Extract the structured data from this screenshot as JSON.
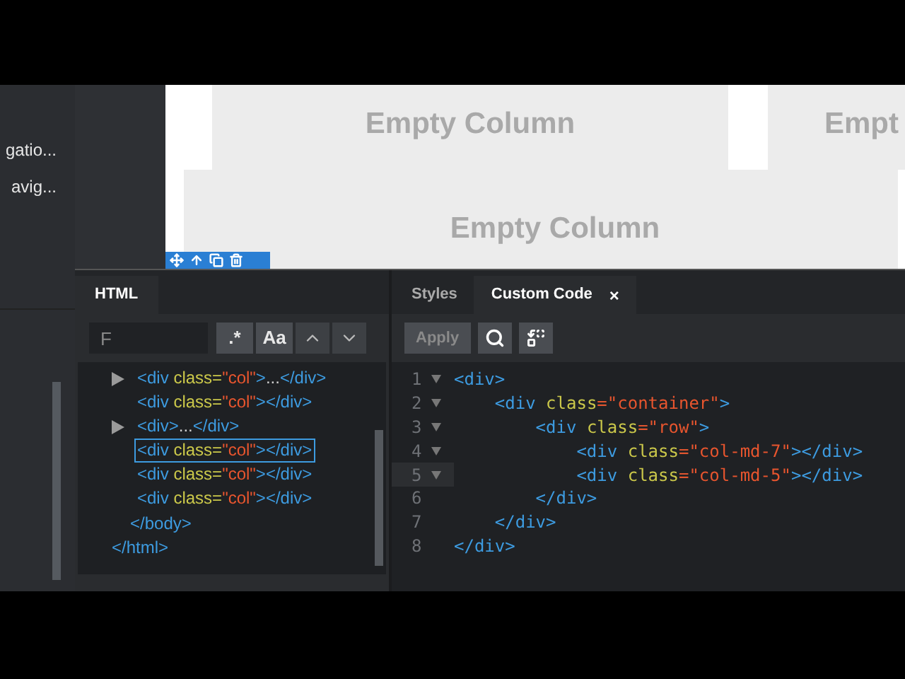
{
  "sidebar": {
    "items": [
      {
        "label": "gatio..."
      },
      {
        "label": "avig..."
      }
    ]
  },
  "canvas": {
    "rows": [
      {
        "columns": [
          {
            "label": "Empty Column"
          },
          {
            "label": "Empt"
          }
        ]
      },
      {
        "columns": [
          {
            "label": "Empty Column"
          }
        ]
      }
    ]
  },
  "html_panel": {
    "tab": {
      "label": "HTML",
      "selected": true
    },
    "search": {
      "placeholder": "F"
    },
    "buttons": [
      ".*",
      "Aa"
    ],
    "tree": [
      {
        "close": "</html>",
        "children": [
          {
            "close": "</body>",
            "children": [
              {
                "text": "<div class=\"col\">...</div>",
                "expandable": true,
                "selected": false
              },
              {
                "text": "<div class=\"col\"></div>",
                "expandable": false,
                "selected": false
              },
              {
                "text": "<div>...</div>",
                "expandable": true,
                "selected": false
              },
              {
                "text": "<div class=\"col\"></div>",
                "expandable": false,
                "selected": true
              },
              {
                "text": "<div class=\"col\"></div>",
                "expandable": false,
                "selected": false
              },
              {
                "text": "<div class=\"col\"></div>",
                "expandable": false,
                "selected": false
              }
            ]
          }
        ]
      }
    ]
  },
  "code_panel": {
    "tabs": [
      {
        "label": "Styles",
        "selected": false
      },
      {
        "label": "Custom Code",
        "selected": true,
        "close": "×"
      }
    ],
    "apply_button": {
      "label": "Apply",
      "disabled": true
    },
    "lines": [
      {
        "number": "1",
        "text": "<div>",
        "foldable": true,
        "active": false
      },
      {
        "number": "2",
        "text": "    <div class=\"container\">",
        "foldable": true,
        "active": false
      },
      {
        "number": "3",
        "text": "        <div class=\"row\">",
        "foldable": true,
        "active": false
      },
      {
        "number": "4",
        "text": "            <div class=\"col-md-7\"></div>",
        "foldable": true,
        "active": false
      },
      {
        "number": "5",
        "text": "            <div class=\"col-md-5\"></div>",
        "foldable": true,
        "active": true
      },
      {
        "number": "6",
        "text": "        </div>",
        "foldable": false,
        "active": false
      },
      {
        "number": "7",
        "text": "    </div>",
        "foldable": false,
        "active": false
      },
      {
        "number": "8",
        "text": "</div>",
        "foldable": false,
        "active": false
      }
    ]
  }
}
